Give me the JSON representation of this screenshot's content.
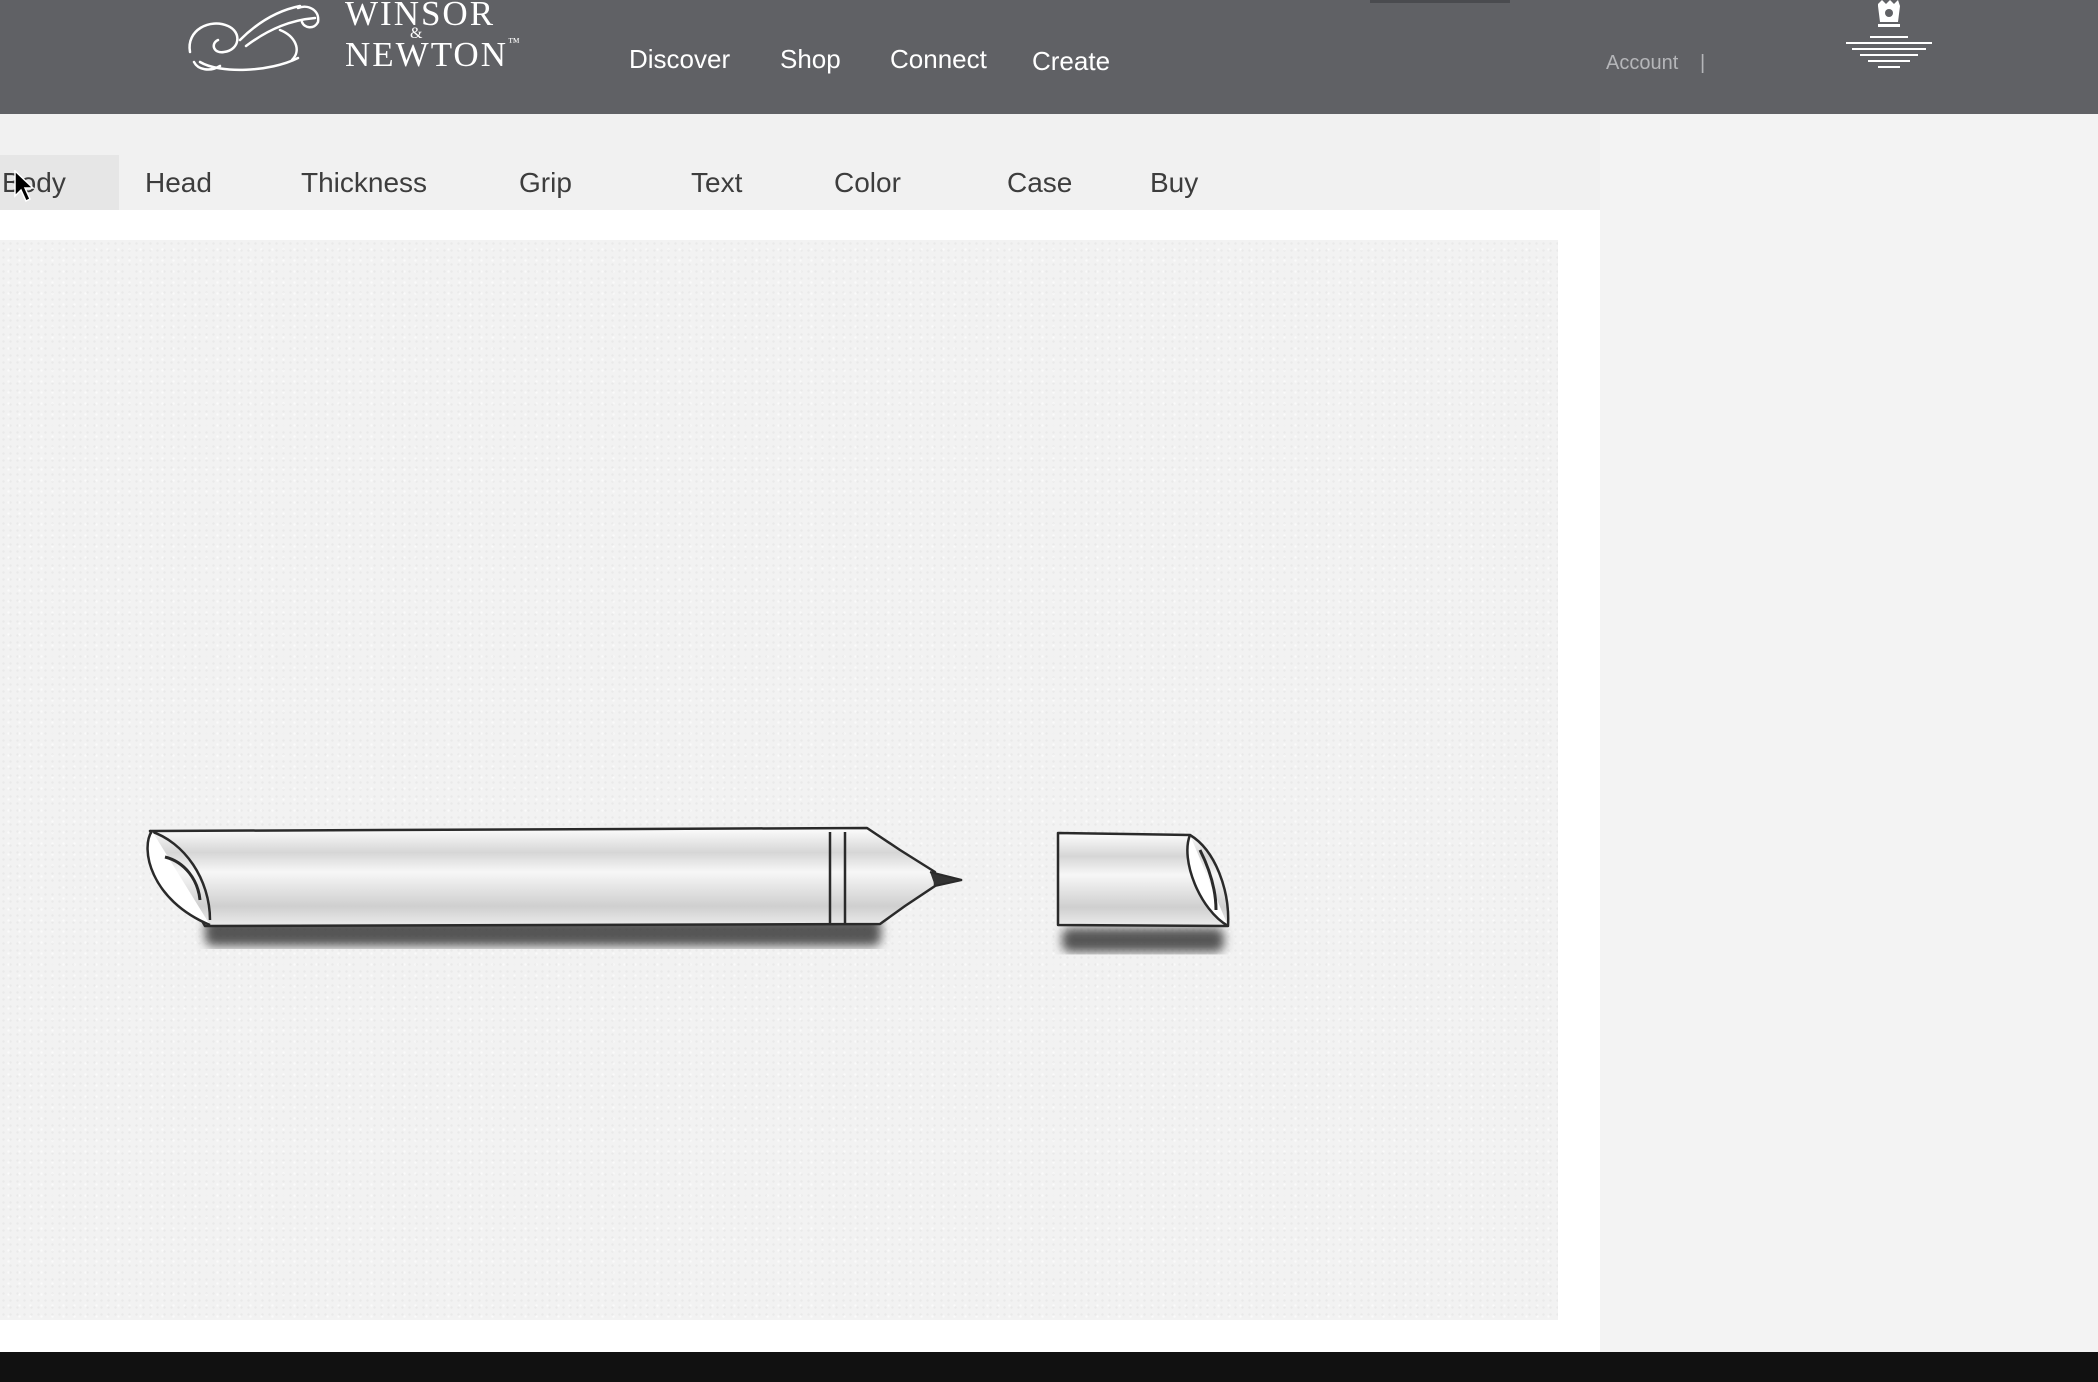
{
  "brand": {
    "line1": "WINSOR",
    "amp": "&",
    "line2": "NEWTON",
    "tm": "™"
  },
  "nav": {
    "items": [
      {
        "label": "Discover"
      },
      {
        "label": "Shop"
      },
      {
        "label": "Connect"
      },
      {
        "label": "Create"
      }
    ]
  },
  "account": {
    "label": "Account",
    "separator": "|"
  },
  "tabs": [
    {
      "label": "Body",
      "active": true
    },
    {
      "label": "Head"
    },
    {
      "label": "Thickness"
    },
    {
      "label": "Grip"
    },
    {
      "label": "Text"
    },
    {
      "label": "Color"
    },
    {
      "label": "Case"
    },
    {
      "label": "Buy"
    }
  ],
  "icons": {
    "logo": "griffin-logo-icon",
    "crest": "royal-warrant-crest-icon",
    "cursor": "mouse-pointer-icon"
  },
  "colors": {
    "header_bg": "#606165",
    "header_text": "#ffffff",
    "account_text": "#b5b6b9",
    "tab_active_bg": "#e6e6e6",
    "canvas_bg": "#f2f2f2"
  }
}
